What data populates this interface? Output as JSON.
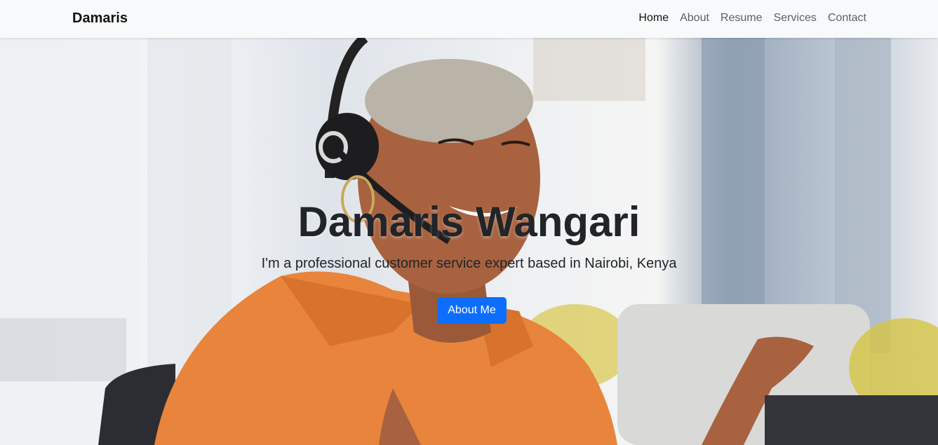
{
  "navbar": {
    "brand": "Damaris",
    "links": [
      "Home",
      "About",
      "Resume",
      "Services",
      "Contact"
    ],
    "active_link": "Home"
  },
  "hero": {
    "title": "Damaris Wangari",
    "subtitle": "I'm a professional customer service expert based in Nairobi, Kenya",
    "button_label": "About Me"
  },
  "colors": {
    "navbar_bg": "#f8f9fa",
    "primary_button": "#0d6efd",
    "text_dark": "#212529",
    "shirt_orange": "#e8843c"
  }
}
